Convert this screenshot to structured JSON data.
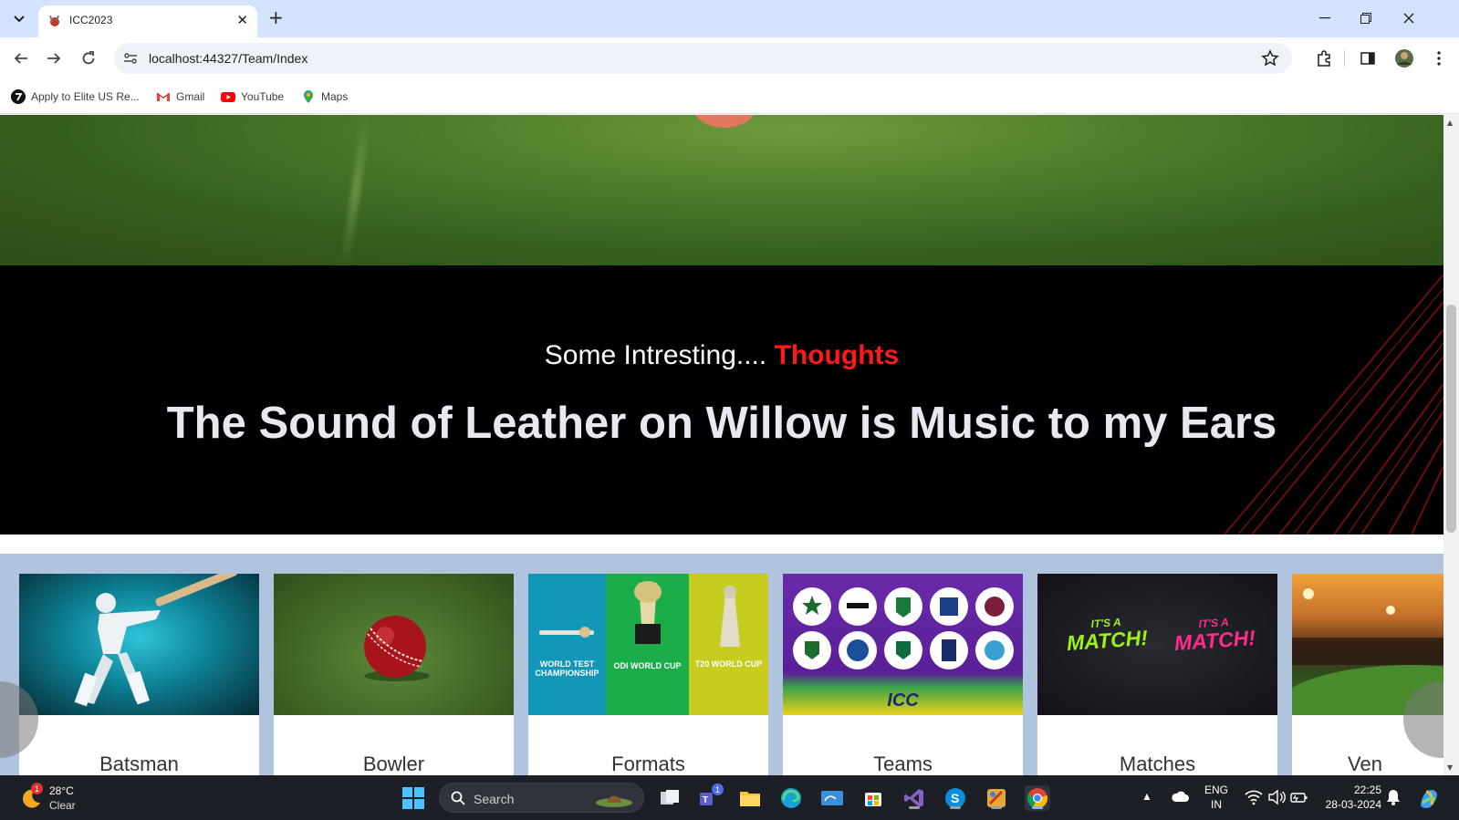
{
  "browser": {
    "tab_title": "ICC2023",
    "url": "localhost:44327/Team/Index",
    "bookmarks": [
      {
        "label": "Apply to Elite US Re...",
        "icon": "elite-icon"
      },
      {
        "label": "Gmail",
        "icon": "gmail-icon"
      },
      {
        "label": "YouTube",
        "icon": "youtube-icon"
      },
      {
        "label": "Maps",
        "icon": "maps-icon"
      }
    ]
  },
  "quote": {
    "intro": "Some Intresting....",
    "intro_accent": "Thoughts",
    "text": "The Sound of Leather on Willow is Music to my Ears",
    "accent_color": "#ff1a1a"
  },
  "cards": [
    {
      "label": "Batsman"
    },
    {
      "label": "Bowler"
    },
    {
      "label": "Formats",
      "img_texts": [
        "WORLD TEST CHAMPIONSHIP",
        "ODI WORLD CUP",
        "T20 WORLD CUP"
      ]
    },
    {
      "label": "Teams",
      "img_texts": [
        "ICC"
      ]
    },
    {
      "label": "Matches",
      "img_texts": [
        "IT'S A",
        "MATCH!",
        "IT'S A",
        "MATCH!"
      ]
    },
    {
      "label": "Ven"
    }
  ],
  "taskbar": {
    "weather_temp": "28°C",
    "weather_desc": "Clear",
    "weather_badge": "1",
    "search_label": "Search",
    "teams_badge": "1",
    "lang_line1": "ENG",
    "lang_line2": "IN",
    "time": "22:25",
    "date": "28-03-2024"
  }
}
